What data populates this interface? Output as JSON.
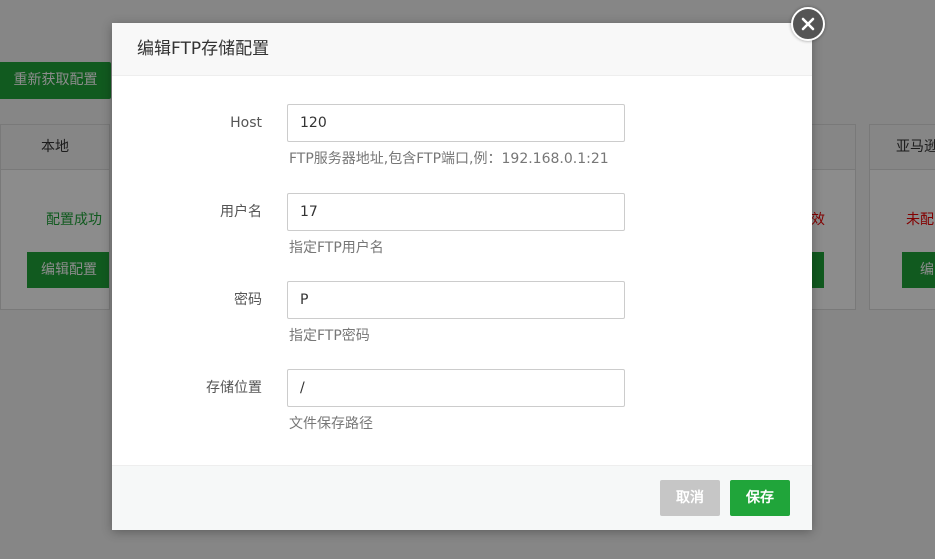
{
  "background": {
    "refresh_button": "重新获取配置",
    "cards": [
      {
        "title": "本地",
        "status": "配置成功",
        "edit": "编辑配置"
      },
      {
        "title": "",
        "status": "效",
        "edit": ""
      },
      {
        "title": "亚马逊",
        "status": "未配",
        "edit": "编"
      }
    ]
  },
  "modal": {
    "title": "编辑FTP存储配置",
    "fields": [
      {
        "label": "Host",
        "value": "120",
        "help": "FTP服务器地址,包含FTP端口,例：192.168.0.1:21"
      },
      {
        "label": "用户名",
        "value": "17",
        "help": "指定FTP用户名"
      },
      {
        "label": "密码",
        "value": "P",
        "help": "指定FTP密码"
      },
      {
        "label": "存储位置",
        "value": "/",
        "help": "文件保存路径"
      }
    ],
    "buttons": {
      "cancel": "取消",
      "save": "保存"
    }
  },
  "colors": {
    "brand_green": "#20a53a",
    "error_red": "#ee0000",
    "disabled_gray": "#c6c6c6"
  },
  "icons": {
    "close": "close-icon"
  }
}
